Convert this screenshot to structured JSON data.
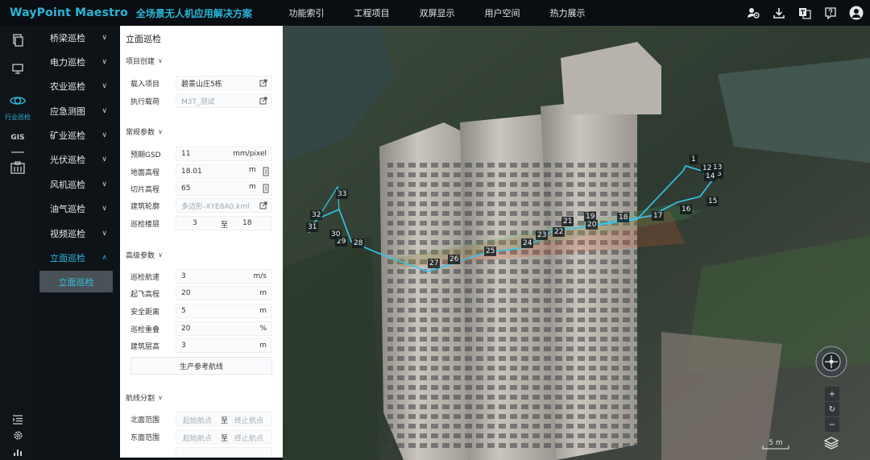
{
  "app": {
    "brand": "WayPoint Maestro",
    "subtitle": "全场景无人机应用解决方案"
  },
  "topnav": [
    "功能索引",
    "工程项目",
    "双屏显示",
    "用户空间",
    "热力展示"
  ],
  "iconbar": {
    "active_label": "行业巡检",
    "gis_label": "GIS"
  },
  "menu": {
    "items": [
      "桥梁巡检",
      "电力巡检",
      "农业巡检",
      "应急测图",
      "矿业巡检",
      "光伏巡检",
      "风机巡检",
      "油气巡检",
      "视频巡检",
      "立面巡检"
    ],
    "active_index": 9,
    "submenu_label": "立面巡检"
  },
  "panel": {
    "title": "立面巡检",
    "project": {
      "section": "项目创建",
      "load_label": "载入项目",
      "load_value": "碧景山庄5栋",
      "payload_label": "执行载荷",
      "payload_value": "M3T_测试"
    },
    "general": {
      "section": "常规参数",
      "gsd_label": "预期GSD",
      "gsd_value": "11",
      "gsd_unit": "mm/pixel",
      "ground_label": "地面高程",
      "ground_value": "18.01",
      "ground_unit": "m",
      "cut_label": "切片高程",
      "cut_value": "65",
      "cut_unit": "m",
      "outline_label": "建筑轮廓",
      "outline_value": "多边形-XYE8A0.kml",
      "floors_label": "巡检楼层",
      "floors_from": "3",
      "floors_sep": "至",
      "floors_to": "18"
    },
    "advanced": {
      "section": "高级参数",
      "speed_label": "巡检航速",
      "speed_value": "3",
      "speed_unit": "m/s",
      "takeoff_label": "起飞高程",
      "takeoff_value": "20",
      "takeoff_unit": "m",
      "safe_label": "安全距离",
      "safe_value": "5",
      "safe_unit": "m",
      "overlap_label": "巡检重叠",
      "overlap_value": "20",
      "overlap_unit": "%",
      "floorh_label": "建筑层高",
      "floorh_value": "3",
      "floorh_unit": "m",
      "generate_button": "生产参考航线"
    },
    "split": {
      "section": "航线分割",
      "start_placeholder": "起始航点",
      "sep": "至",
      "end_placeholder": "终止航点",
      "rows": [
        "北面范围",
        "东面范围"
      ]
    }
  },
  "scene": {
    "waypoints": [
      "1",
      "3",
      "12",
      "13",
      "14",
      "15",
      "16",
      "17",
      "18",
      "19",
      "20",
      "21",
      "22",
      "23",
      "24",
      "25",
      "26",
      "27",
      "28",
      "29",
      "30",
      "31",
      "32",
      "33"
    ],
    "scale_label": "5 m"
  },
  "colors": {
    "accent": "#2eb8da",
    "route": "#35c6ee"
  }
}
